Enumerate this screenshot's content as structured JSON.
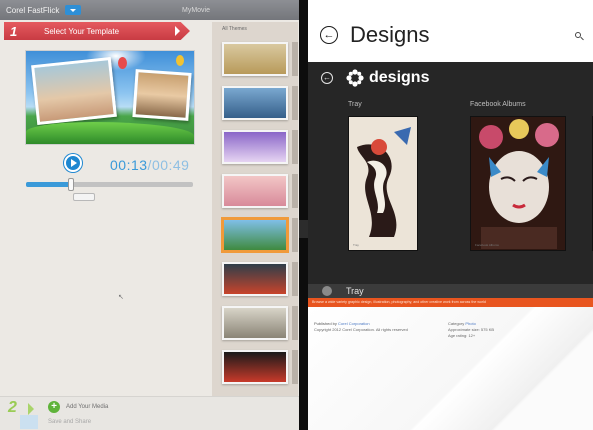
{
  "left_app": {
    "title": "Corel FastFlick",
    "project_name": "MyMovie",
    "step1": {
      "number": "1",
      "label": "Select Your Template"
    },
    "player": {
      "current_time": "00:13",
      "separator": "/",
      "duration": "00:49",
      "progress": 0.27
    },
    "template_panel_header": "All Themes",
    "templates": [
      {
        "name": "template-1",
        "colors": [
          "#d9c9a0",
          "#b89a5a"
        ]
      },
      {
        "name": "template-2",
        "colors": [
          "#7aa8d0",
          "#355f8a"
        ]
      },
      {
        "name": "template-3",
        "colors": [
          "#8a66c8",
          "#e6d4f2"
        ]
      },
      {
        "name": "template-4",
        "colors": [
          "#f2c6c6",
          "#d88a9a"
        ]
      },
      {
        "name": "template-5",
        "colors": [
          "#7fbfe8",
          "#3f8a3f"
        ],
        "selected": true
      },
      {
        "name": "template-6",
        "colors": [
          "#2e3e4a",
          "#c8442c"
        ]
      },
      {
        "name": "template-7",
        "colors": [
          "#d8d4c8",
          "#8a8476"
        ]
      },
      {
        "name": "template-8",
        "colors": [
          "#1a1a1a",
          "#c83a2a"
        ]
      }
    ],
    "step2": {
      "number": "2",
      "label": "Add Your Media"
    },
    "step3": {
      "label": "Save and Share"
    }
  },
  "right_app": {
    "title": "Designs",
    "app_name": "designs",
    "screenshots": [
      {
        "label": "Tray",
        "caption": "Tray"
      },
      {
        "label": "Facebook Albums",
        "caption": "Facebook Albums"
      },
      {
        "label": "",
        "caption": ""
      }
    ],
    "tray_title": "Tray",
    "description": "Browse a wide variety graphic design, illustration, photography, and other creative work from across the world",
    "published_by_label": "Published by",
    "publisher": "Corel Corporation",
    "copyright": "Copyright 2012 Corel Corporation. All rights reserved",
    "category_label": "Category",
    "category": "Photo",
    "size_label": "Approximate size: 575 KB",
    "age_rating": "Age rating: 12+"
  },
  "colors": {
    "accent_blue": "#3a9ad9",
    "step_red": "#d94a50",
    "store_orange": "#e8551f"
  }
}
